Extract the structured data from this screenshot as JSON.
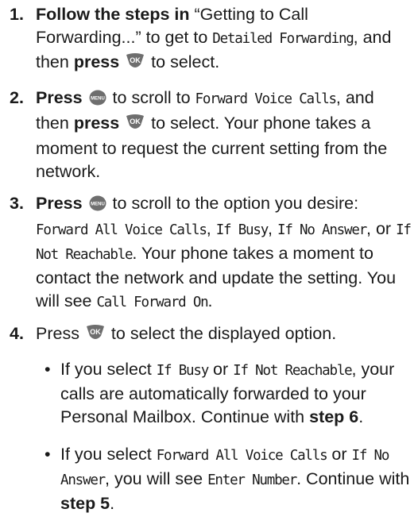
{
  "icons": {
    "ok_key": "ok-key-icon",
    "menu_key": "menu-key-icon"
  },
  "colors": {
    "key_fill": "#6e6e6e",
    "text": "#1a1a1a"
  },
  "steps": [
    {
      "number": "1.",
      "parts": {
        "a": "Follow the steps in",
        "b": " “Getting to Call Forwarding...” to get to ",
        "c": "Detailed Forwarding",
        "d": ", and then ",
        "e": "press",
        "f": " to select."
      }
    },
    {
      "number": "2.",
      "parts": {
        "a": "Press",
        "b": " to scroll to ",
        "c": "Forward Voice Calls",
        "d": ", and then ",
        "e": "press",
        "f": " to select. Your phone takes a moment to request the current setting from the network."
      }
    },
    {
      "number": "3.",
      "parts": {
        "a": "Press",
        "b": " to scroll to the option you desire: ",
        "c": "Forward All Voice Calls",
        "d": ", ",
        "e": "If Busy",
        "f": ", ",
        "g": "If No Answer",
        "h": ", or ",
        "i": "If Not Reachable",
        "j": ". Your phone takes a moment to contact the network and update the setting. You will see ",
        "k": "Call Forward On",
        "l": "."
      }
    },
    {
      "number": "4.",
      "parts": {
        "a": "Press",
        "b": " to select the displayed option."
      }
    }
  ],
  "bullets": [
    {
      "marker": "•",
      "parts": {
        "a": "If you select ",
        "b": "If Busy",
        "c": " or ",
        "d": "If Not Reachable",
        "e": ", your calls are automatically forwarded to your Personal Mailbox. Continue with ",
        "f": "step 6",
        "g": "."
      }
    },
    {
      "marker": "•",
      "parts": {
        "a": "If you select ",
        "b": "Forward All Voice Calls",
        "c": " or ",
        "d": "If No Answer",
        "e": ", you will see ",
        "f": "Enter Number",
        "g": ". Continue with ",
        "h": "step 5",
        "i": "."
      }
    }
  ]
}
